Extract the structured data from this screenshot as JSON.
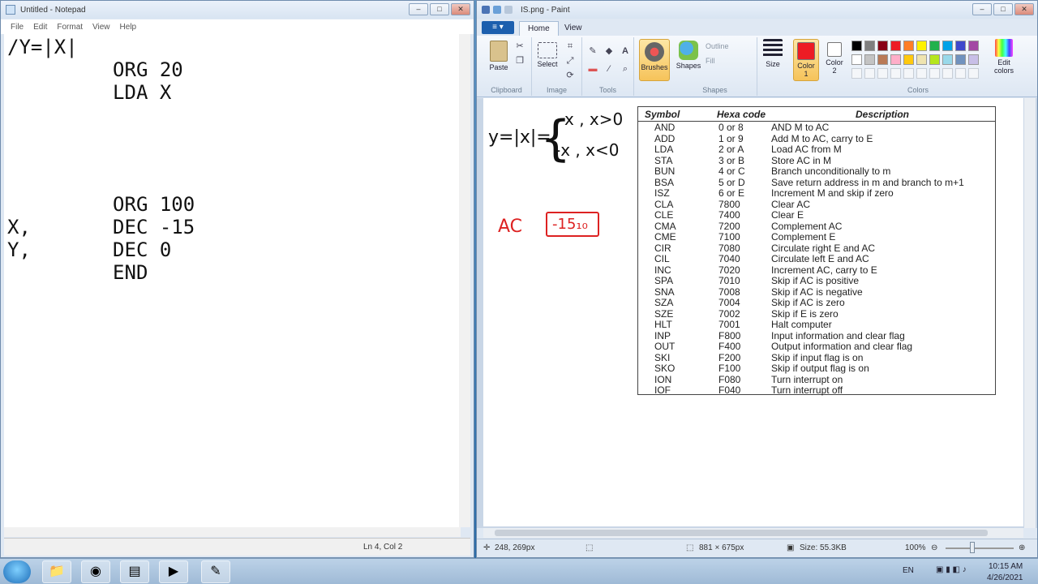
{
  "notepad": {
    "title": "Untitled - Notepad",
    "menu": [
      "File",
      "Edit",
      "Format",
      "View",
      "Help"
    ],
    "lines": [
      "/Y=|X|",
      "         ORG 20",
      "         LDA X",
      "",
      "",
      "",
      "         ORG 100",
      "X,       DEC -15",
      "Y,       DEC 0",
      "         END"
    ],
    "status": "Ln 4, Col 2"
  },
  "paint": {
    "title": "IS.png - Paint",
    "tabs": [
      "Home",
      "View"
    ],
    "groups": {
      "clipboard": "Clipboard",
      "image": "Image",
      "tools": "Tools",
      "shapes": "Shapes",
      "colors": "Colors"
    },
    "buttons": {
      "paste": "Paste",
      "select": "Select",
      "brushes": "Brushes",
      "shapes": "Shapes",
      "outline": "Outline",
      "fill": "Fill",
      "size": "Size",
      "color1": "Color 1",
      "color2": "Color 2",
      "edit_colors": "Edit colors"
    },
    "palette_top": [
      "#000000",
      "#7f7f7f",
      "#880015",
      "#ed1c24",
      "#ff7f27",
      "#fff200",
      "#22b14c",
      "#00a2e8",
      "#3f48cc",
      "#a349a4"
    ],
    "palette_bottom": [
      "#ffffff",
      "#c3c3c3",
      "#b97a57",
      "#ffaec9",
      "#ffc90e",
      "#efe4b0",
      "#b5e61d",
      "#99d9ea",
      "#7092be",
      "#c8bfe7"
    ],
    "color1": "#ed1c24",
    "color2": "#ffffff",
    "status": {
      "cursor": "248, 269px",
      "dimensions": "881 × 675px",
      "size": "Size: 55.3KB",
      "zoom": "100%"
    },
    "handwriting": {
      "eq_lhs": "y=|x|=",
      "case1": "x , x>0",
      "case2": "-x , x<0",
      "ac_label": "AC",
      "ac_value": "-15₁₀"
    },
    "table": {
      "headers": [
        "Symbol",
        "Hexa code",
        "Description"
      ],
      "rows": [
        [
          "AND",
          "0 or 8",
          "AND M to AC"
        ],
        [
          "ADD",
          "1 or 9",
          "Add M to AC, carry to E"
        ],
        [
          "LDA",
          "2 or A",
          "Load AC from M"
        ],
        [
          "STA",
          "3 or B",
          "Store AC in M"
        ],
        [
          "BUN",
          "4 or C",
          "Branch unconditionally  to m"
        ],
        [
          "BSA",
          "5 or D",
          "Save return  address in m and branch to m+1"
        ],
        [
          "ISZ",
          "6 or E",
          "Increment  M and skip if zero"
        ],
        [
          "CLA",
          "7800",
          "Clear AC"
        ],
        [
          "CLE",
          "7400",
          "Clear E"
        ],
        [
          "CMA",
          "7200",
          "Complement AC"
        ],
        [
          "CME",
          "7100",
          "Complement E"
        ],
        [
          "CIR",
          "7080",
          "Circulate right E and AC"
        ],
        [
          "CIL",
          "7040",
          "Circulate left E and AC"
        ],
        [
          "INC",
          "7020",
          "Increment  AC, carry to E"
        ],
        [
          "SPA",
          "7010",
          "Skip if AC is positive"
        ],
        [
          "SNA",
          "7008",
          "Skip if AC is negative"
        ],
        [
          "SZA",
          "7004",
          "Skip if AC is zero"
        ],
        [
          "SZE",
          "7002",
          "Skip if E is zero"
        ],
        [
          "HLT",
          "7001",
          "Halt computer"
        ],
        [
          "INP",
          "F800",
          "Input  information and clear flag"
        ],
        [
          "OUT",
          "F400",
          "Output  information and clear flag"
        ],
        [
          "SKI",
          "F200",
          "Skip if input flag is on"
        ],
        [
          "SKO",
          "F100",
          "Skip if output  flag is on"
        ],
        [
          "ION",
          "F080",
          "Turn  interrupt  on"
        ],
        [
          "IOF",
          "F040",
          "Turn  interrupt  off"
        ]
      ]
    }
  },
  "taskbar": {
    "lang": "EN",
    "time": "10:15 AM",
    "date": "4/26/2021"
  }
}
